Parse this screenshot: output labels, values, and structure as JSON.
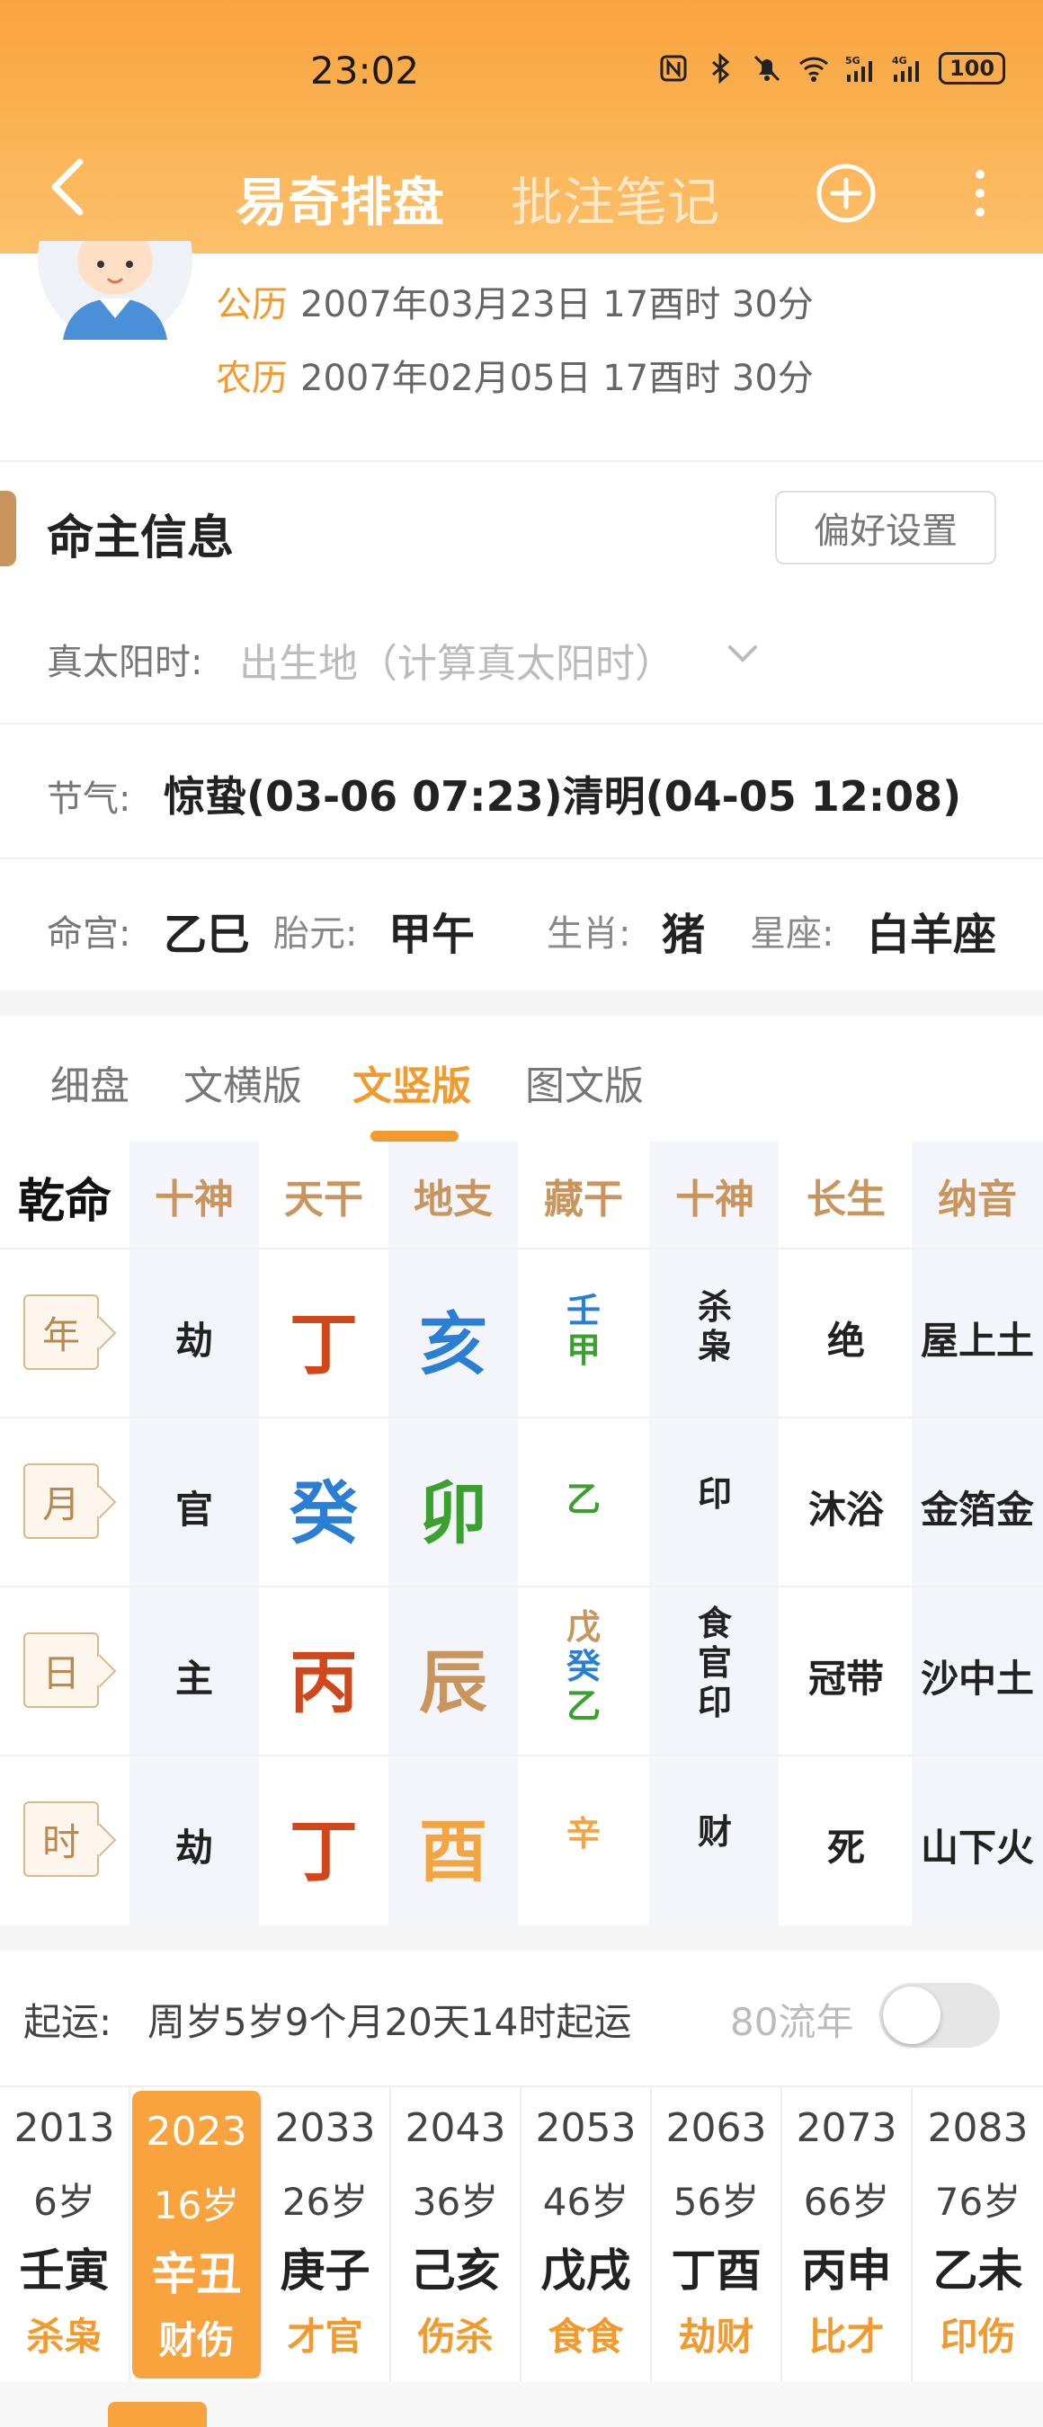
{
  "status": {
    "time": "23:02",
    "battery": "100"
  },
  "nav": {
    "active_tab": "易奇排盘",
    "other_tab": "批注笔记"
  },
  "profile": {
    "solar_label": "公历",
    "solar_value": "2007年03月23日 17酉时 30分",
    "lunar_label": "农历",
    "lunar_value": "2007年02月05日 17酉时 30分"
  },
  "info": {
    "section_title": "命主信息",
    "pref_button": "偏好设置",
    "tst_label": "真太阳时:",
    "tst_placeholder": "出生地（计算真太阳时）",
    "jieqi_label": "节气:",
    "jieqi_value": "惊蛰(03-06 07:23)清明(04-05 12:08)",
    "minggong_label": "命宫:",
    "minggong_value": "乙巳",
    "taiyuan_label": "胎元:",
    "taiyuan_value": "甲午",
    "shengxiao_label": "生肖:",
    "shengxiao_value": "猪",
    "xingzuo_label": "星座:",
    "xingzuo_value": "白羊座"
  },
  "view_tabs": [
    "细盘",
    "文横版",
    "文竖版",
    "图文版"
  ],
  "grid": {
    "headers": [
      "乾命",
      "十神",
      "天干",
      "地支",
      "藏干",
      "十神",
      "长生",
      "纳音"
    ],
    "rows": [
      {
        "pillar": "年",
        "shishen": "劫",
        "tiangan": "丁",
        "dizhi": "亥",
        "canggan": [
          "壬",
          "甲"
        ],
        "cang_shishen": [
          "杀",
          "枭"
        ],
        "changsheng": "绝",
        "nayin": "屋上土"
      },
      {
        "pillar": "月",
        "shishen": "官",
        "tiangan": "癸",
        "dizhi": "卯",
        "canggan": [
          "乙"
        ],
        "cang_shishen": [
          "印"
        ],
        "changsheng": "沐浴",
        "nayin": "金箔金"
      },
      {
        "pillar": "日",
        "shishen": "主",
        "tiangan": "丙",
        "dizhi": "辰",
        "canggan": [
          "戊",
          "癸",
          "乙"
        ],
        "cang_shishen": [
          "食",
          "官",
          "印"
        ],
        "changsheng": "冠带",
        "nayin": "沙中土"
      },
      {
        "pillar": "时",
        "shishen": "劫",
        "tiangan": "丁",
        "dizhi": "酉",
        "canggan": [
          "辛"
        ],
        "cang_shishen": [
          "财"
        ],
        "changsheng": "死",
        "nayin": "山下火"
      }
    ]
  },
  "qiyun": {
    "label": "起运:",
    "value": "周岁5岁9个月20天14时起运",
    "liunian_label": "80流年"
  },
  "dayun": [
    {
      "year": "2013",
      "age": "6岁",
      "ganzhi": "壬寅",
      "shishen": "杀枭"
    },
    {
      "year": "2023",
      "age": "16岁",
      "ganzhi": "辛丑",
      "shishen": "财伤"
    },
    {
      "year": "2033",
      "age": "26岁",
      "ganzhi": "庚子",
      "shishen": "才官"
    },
    {
      "year": "2043",
      "age": "36岁",
      "ganzhi": "己亥",
      "shishen": "伤杀"
    },
    {
      "year": "2053",
      "age": "46岁",
      "ganzhi": "戊戌",
      "shishen": "食食"
    },
    {
      "year": "2063",
      "age": "56岁",
      "ganzhi": "丁酉",
      "shishen": "劫财"
    },
    {
      "year": "2073",
      "age": "66岁",
      "ganzhi": "丙申",
      "shishen": "比才"
    },
    {
      "year": "2083",
      "age": "76岁",
      "ganzhi": "乙未",
      "shishen": "印伤"
    }
  ],
  "colors": {
    "accent": "#f9a33f",
    "fire": "#d2471a",
    "water": "#2a7fd4",
    "wood": "#3aa030",
    "earth": "#c9955c",
    "metal": "#f2a540"
  },
  "icons": [
    "back-arrow-icon",
    "add-circle-icon",
    "more-vertical-icon",
    "nfc-icon",
    "bluetooth-icon",
    "mute-icon",
    "wifi-icon",
    "signal-5g-icon",
    "signal-4g-icon",
    "battery-icon",
    "chevron-down-icon",
    "avatar-image"
  ]
}
